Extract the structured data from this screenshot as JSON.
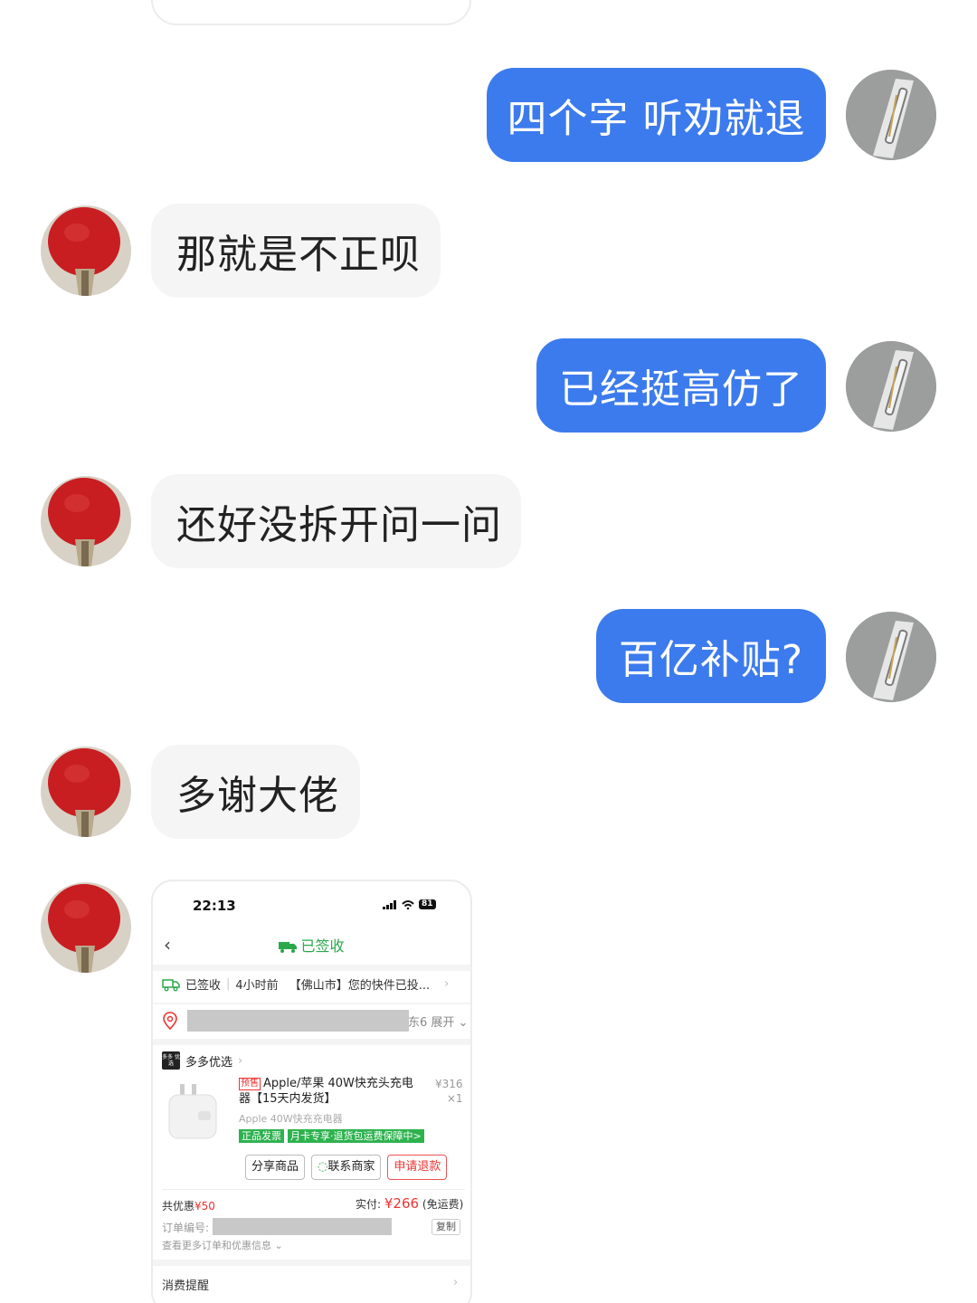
{
  "messages": [
    {
      "side": "me",
      "text": "四个字 听劝就退"
    },
    {
      "side": "them",
      "text": "那就是不正呗"
    },
    {
      "side": "me",
      "text": "已经挺高仿了"
    },
    {
      "side": "them",
      "text": "还好没拆开问一问"
    },
    {
      "side": "me",
      "text": "百亿补贴?"
    },
    {
      "side": "them",
      "text": "多谢大佬"
    }
  ],
  "screenshot": {
    "status_time": "22:13",
    "battery": "81",
    "nav_title": "已签收",
    "tracking": {
      "status": "已签收",
      "time": "4小时前",
      "text": "【佛山市】您的快件已投..."
    },
    "address_tail": "东6 展开",
    "store_logo": "多多 优选",
    "store": "多多优选",
    "product": {
      "presale_tag": "预售",
      "title": "Apple/苹果 40W快充头充电器【15天内发货】",
      "price": "¥316",
      "qty": "×1",
      "subtitle": "Apple 40W快充充电器",
      "tags": [
        "正品发票",
        "月卡专享·退货包运费保障中>"
      ]
    },
    "buttons": {
      "share": "分享商品",
      "contact": "联系商家",
      "refund": "申请退款"
    },
    "discount_label": "共优惠",
    "discount_value": "¥50",
    "paid_label": "实付:",
    "paid_value": "¥266",
    "paid_note": "(免运费)",
    "order_label": "订单编号:",
    "copy": "复制",
    "more": "查看更多订单和优惠信息",
    "reminder": "消费提醒"
  },
  "colors": {
    "my_bubble": "#3c7bed",
    "their_bubble": "#f5f5f5",
    "green": "#2aa84a",
    "red": "#e33333"
  }
}
